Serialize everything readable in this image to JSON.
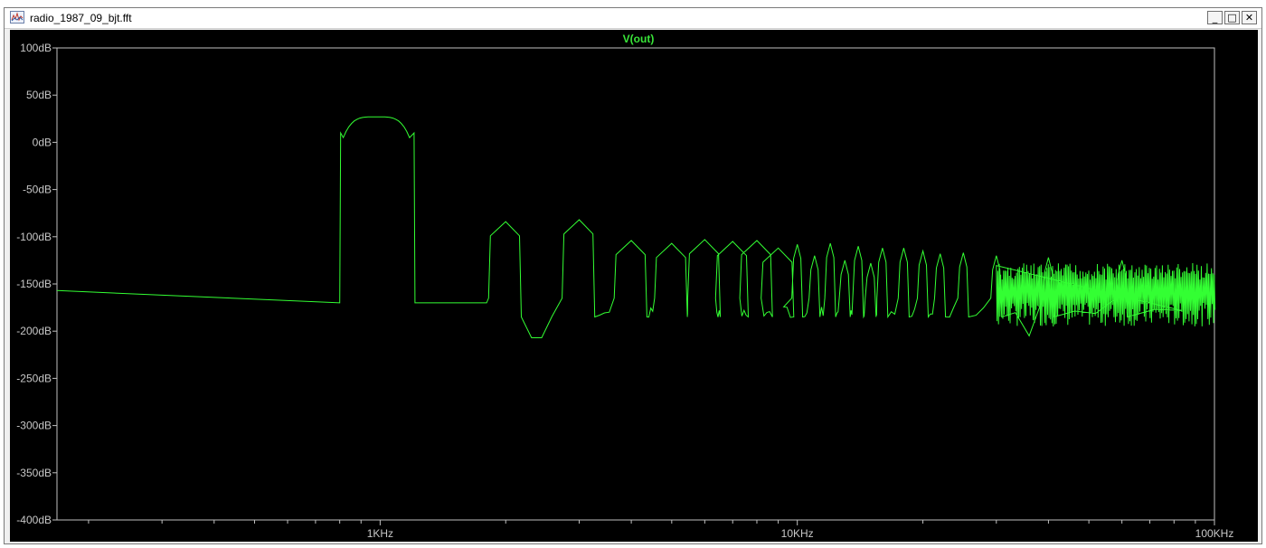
{
  "window": {
    "title": "radio_1987_09_bjt.fft",
    "minimize_glyph": "_",
    "maximize_glyph": "□",
    "close_glyph": "✕",
    "icon": "waveform-icon"
  },
  "colors": {
    "plot_background": "#000000",
    "trace": "#33ff33",
    "axis": "#bfbfbf",
    "trace_title": "#39e639"
  },
  "chart_data": {
    "type": "line",
    "title": "V(out)",
    "xlabel": "",
    "ylabel": "",
    "x_scale": "log",
    "xlim": [
      168,
      100000
    ],
    "ylim": [
      -400,
      100
    ],
    "y_ticks": [
      100,
      50,
      0,
      -50,
      -100,
      -150,
      -200,
      -250,
      -300,
      -350,
      -400
    ],
    "y_tick_labels": [
      "100dB",
      "50dB",
      "0dB",
      "-50dB",
      "-100dB",
      "-150dB",
      "-200dB",
      "-250dB",
      "-300dB",
      "-350dB",
      "-400dB"
    ],
    "x_ticks": [
      1000,
      10000,
      100000
    ],
    "x_tick_labels": [
      "1KHz",
      "10KHz",
      "100KHz"
    ],
    "grid": false,
    "series": [
      {
        "name": "V(out)",
        "fundamental": {
          "freq": 1000,
          "peak_db": 27,
          "band_low": 800,
          "band_high": 1200,
          "floor_db": -170
        },
        "noise_floor": {
          "start": [
            168,
            -157
          ],
          "end": [
            800,
            -170
          ]
        },
        "harmonic_peaks": [
          {
            "f": 2000,
            "db": -84
          },
          {
            "f": 3000,
            "db": -82
          },
          {
            "f": 4000,
            "db": -104
          },
          {
            "f": 5000,
            "db": -107
          },
          {
            "f": 6000,
            "db": -103
          },
          {
            "f": 7000,
            "db": -105
          },
          {
            "f": 8000,
            "db": -104
          },
          {
            "f": 9000,
            "db": -112
          },
          {
            "f": 10000,
            "db": -108
          },
          {
            "f": 11000,
            "db": -120
          },
          {
            "f": 12000,
            "db": -107
          },
          {
            "f": 13000,
            "db": -125
          },
          {
            "f": 14000,
            "db": -110
          },
          {
            "f": 15000,
            "db": -128
          },
          {
            "f": 16000,
            "db": -112
          },
          {
            "f": 18000,
            "db": -112
          },
          {
            "f": 20000,
            "db": -115
          },
          {
            "f": 22000,
            "db": -118
          },
          {
            "f": 25000,
            "db": -117
          },
          {
            "f": 30000,
            "db": -120
          },
          {
            "f": 40000,
            "db": -122
          },
          {
            "f": 60000,
            "db": -125
          },
          {
            "f": 100000,
            "db": -128
          }
        ],
        "inter_harmonic_floor_db": -180,
        "notch_dips": [
          {
            "f": 2400,
            "db": -207
          },
          {
            "f": 37000,
            "db": -205
          }
        ],
        "high_freq_floor_db": [
          -150,
          -195
        ]
      }
    ]
  }
}
